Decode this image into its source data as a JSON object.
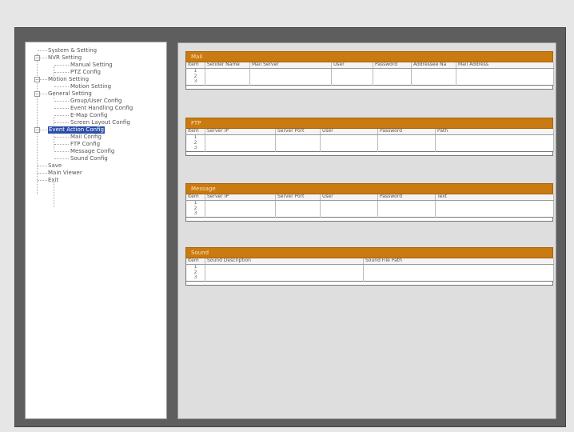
{
  "tree": {
    "items": [
      {
        "label": "System & Setting",
        "level": 0,
        "expander": ""
      },
      {
        "label": "NVR Setting",
        "level": 0,
        "expander": "−"
      },
      {
        "label": "Manual Setting",
        "level": 2,
        "expander": ""
      },
      {
        "label": "PTZ Config",
        "level": 2,
        "expander": ""
      },
      {
        "label": "Motion Setting",
        "level": 0,
        "expander": "−"
      },
      {
        "label": "Motion Setting",
        "level": 2,
        "expander": ""
      },
      {
        "label": "General Setting",
        "level": 0,
        "expander": "−"
      },
      {
        "label": "Group/User Config",
        "level": 2,
        "expander": ""
      },
      {
        "label": "Event Handling Config",
        "level": 2,
        "expander": ""
      },
      {
        "label": "E-Map Config",
        "level": 2,
        "expander": ""
      },
      {
        "label": "Screen Layout Config",
        "level": 2,
        "expander": ""
      },
      {
        "label": "Event Action Config",
        "level": 0,
        "expander": "−",
        "selected": true
      },
      {
        "label": "Mail Config",
        "level": 2,
        "expander": ""
      },
      {
        "label": "FTP Config",
        "level": 2,
        "expander": ""
      },
      {
        "label": "Message Config",
        "level": 2,
        "expander": ""
      },
      {
        "label": "Sound Config",
        "level": 2,
        "expander": ""
      },
      {
        "label": "Save",
        "level": 0,
        "expander": ""
      },
      {
        "label": "Main Viewer",
        "level": 0,
        "expander": ""
      },
      {
        "label": "Exit",
        "level": 0,
        "expander": ""
      }
    ]
  },
  "sections": [
    {
      "title": "Mail",
      "columns": [
        "Item",
        "Sender Name",
        "Mail Server",
        "User",
        "Password",
        "Addressee Na",
        "Mail Address"
      ],
      "rows": [
        [
          "1",
          "",
          "",
          "",
          "",
          "",
          ""
        ],
        [
          "2",
          "",
          "",
          "",
          "",
          "",
          ""
        ],
        [
          "3",
          "",
          "",
          "",
          "",
          "",
          ""
        ]
      ]
    },
    {
      "title": "FTP",
      "columns": [
        "Item",
        "Server IP",
        "Server Port",
        "User",
        "Password",
        "Path"
      ],
      "rows": [
        [
          "1",
          "",
          "",
          "",
          "",
          ""
        ],
        [
          "2",
          "",
          "",
          "",
          "",
          ""
        ],
        [
          "3",
          "",
          "",
          "",
          "",
          ""
        ]
      ]
    },
    {
      "title": "Message",
      "columns": [
        "Item",
        "Server IP",
        "Server Port",
        "User",
        "Password",
        "Text"
      ],
      "rows": [
        [
          "1",
          "",
          "",
          "",
          "",
          ""
        ],
        [
          "2",
          "",
          "",
          "",
          "",
          ""
        ],
        [
          "3",
          "",
          "",
          "",
          "",
          ""
        ]
      ]
    },
    {
      "title": "Sound",
      "columns": [
        "Item",
        "Sound Description",
        "Sound File Path"
      ],
      "rows": [
        [
          "1",
          "",
          ""
        ],
        [
          "2",
          "",
          ""
        ],
        [
          "3",
          "",
          ""
        ]
      ]
    }
  ],
  "colors": {
    "section_header": "#c97a10",
    "selection": "#2a4ea8"
  }
}
